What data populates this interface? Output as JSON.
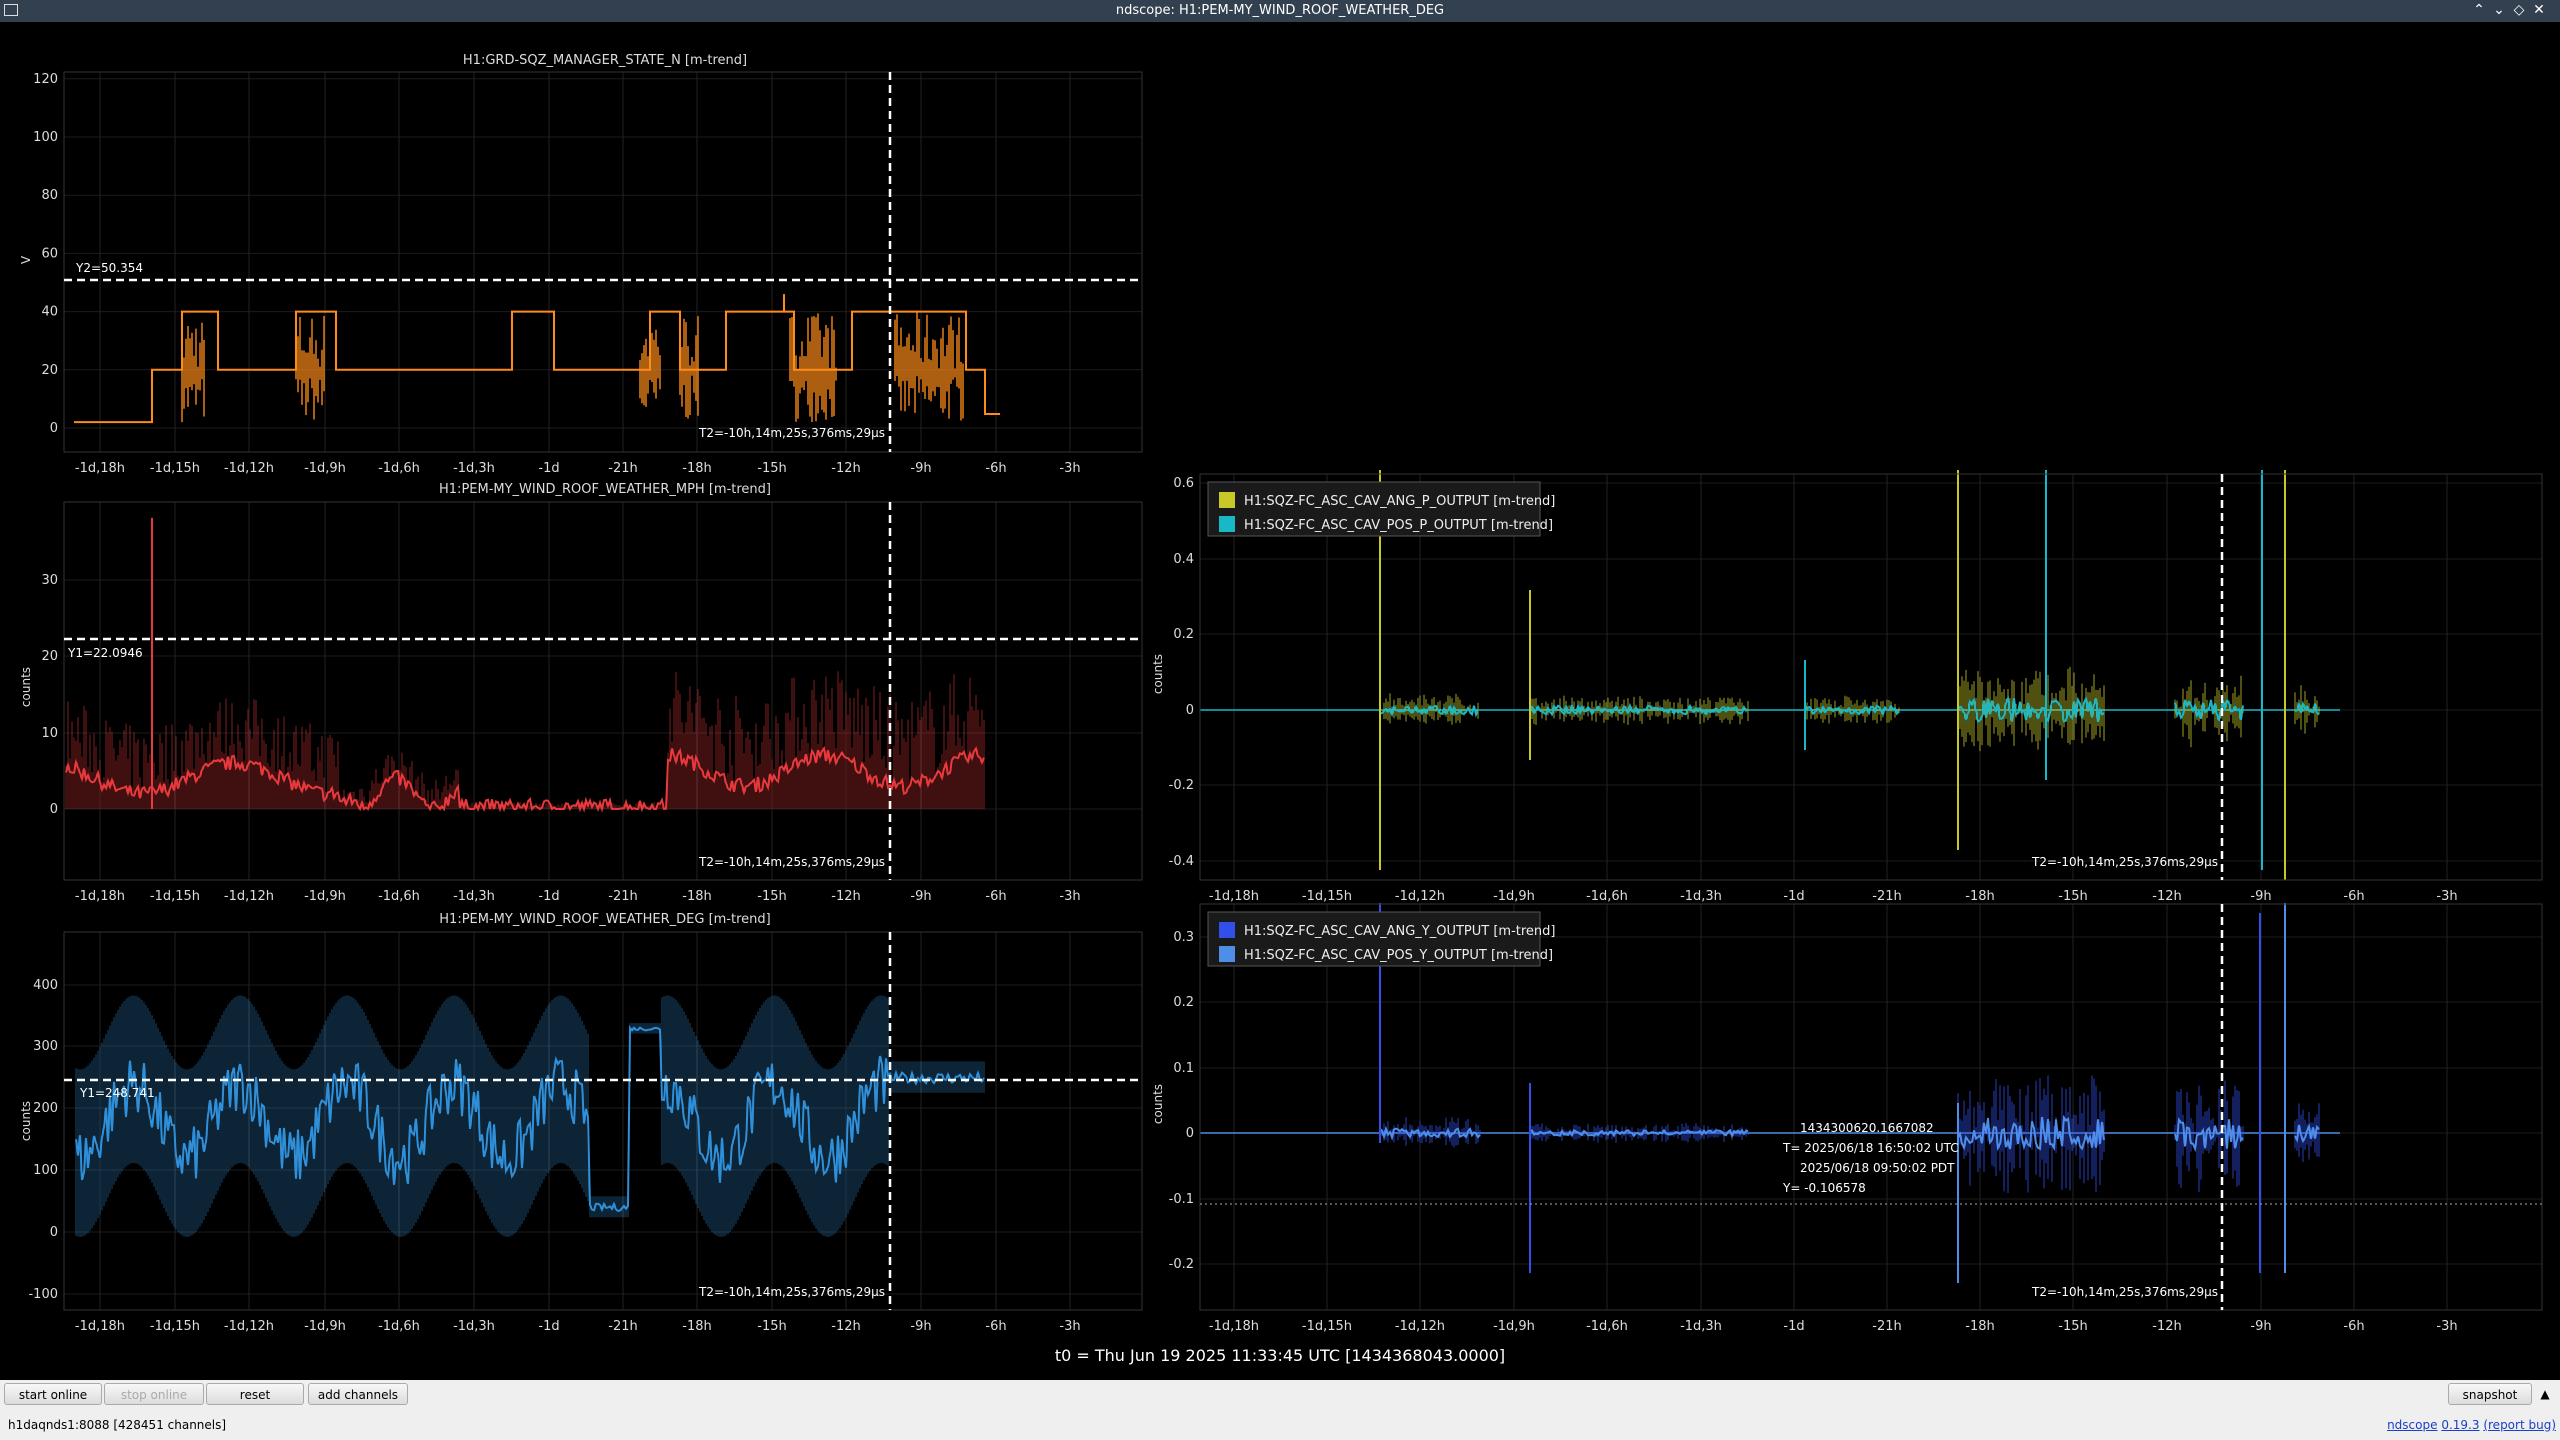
{
  "window": {
    "title": "ndscope: H1:PEM-MY_WIND_ROOF_WEATHER_DEG"
  },
  "colors": {
    "orange": "#ff8c1a",
    "red": "#e8393d",
    "blue": "#2f8fd8",
    "yellow": "#c8c828",
    "cyan": "#19b8c9",
    "darkblue": "#3050e8",
    "lightblue": "#4e8ee8"
  },
  "time_ticks": [
    "-1d,18h",
    "-1d,15h",
    "-1d,12h",
    "-1d,9h",
    "-1d,6h",
    "-1d,3h",
    "-1d",
    "-21h",
    "-18h",
    "-15h",
    "-12h",
    "-9h",
    "-6h",
    "-3h"
  ],
  "t2_label": "T2=-10h,14m,25s,376ms,29µs",
  "plots": {
    "p1": {
      "title": "H1:GRD-SQZ_MANAGER_STATE_N [m-trend]",
      "ylabel": "V",
      "yticks": [
        "0",
        "20",
        "40",
        "60",
        "80",
        "100",
        "120"
      ],
      "cursor_label": "Y2=50.354"
    },
    "p2": {
      "title": "H1:PEM-MY_WIND_ROOF_WEATHER_MPH [m-trend]",
      "ylabel": "counts",
      "yticks": [
        "0",
        "10",
        "20",
        "30"
      ],
      "cursor_label": "Y1=22.0946"
    },
    "p3": {
      "title": "H1:PEM-MY_WIND_ROOF_WEATHER_DEG [m-trend]",
      "ylabel": "counts",
      "yticks": [
        "-100",
        "0",
        "100",
        "200",
        "300",
        "400"
      ],
      "cursor_label": "Y1=248.741"
    },
    "p4": {
      "ylabel": "counts",
      "yticks": [
        "-0.4",
        "-0.2",
        "0",
        "0.2",
        "0.4",
        "0.6"
      ],
      "legend": [
        "H1:SQZ-FC_ASC_CAV_ANG_P_OUTPUT [m-trend]",
        "H1:SQZ-FC_ASC_CAV_POS_P_OUTPUT [m-trend]"
      ]
    },
    "p5": {
      "ylabel": "counts",
      "yticks": [
        "-0.2",
        "-0.1",
        "0",
        "0.1",
        "0.2",
        "0.3"
      ],
      "legend": [
        "H1:SQZ-FC_ASC_CAV_ANG_Y_OUTPUT [m-trend]",
        "H1:SQZ-FC_ASC_CAV_POS_Y_OUTPUT [m-trend]"
      ],
      "hover": {
        "gps": "1434300620.1667082",
        "utc": "T= 2025/06/18 16:50:02 UTC",
        "pdt": "2025/06/18 09:50:02 PDT",
        "y": "Y= -0.106578"
      }
    }
  },
  "t0_text": "t0 = Thu Jun 19 2025 11:33:45 UTC [1434368043.0000]",
  "buttons": {
    "start_online": "start online",
    "stop_online": "stop online",
    "reset": "reset",
    "add_channels": "add channels",
    "snapshot": "snapshot"
  },
  "status": {
    "server": "h1daqnds1:8088  [428451 channels]",
    "version_prefix": "ndscope",
    "version": "0.19.3",
    "report_bug": "(report bug)"
  }
}
